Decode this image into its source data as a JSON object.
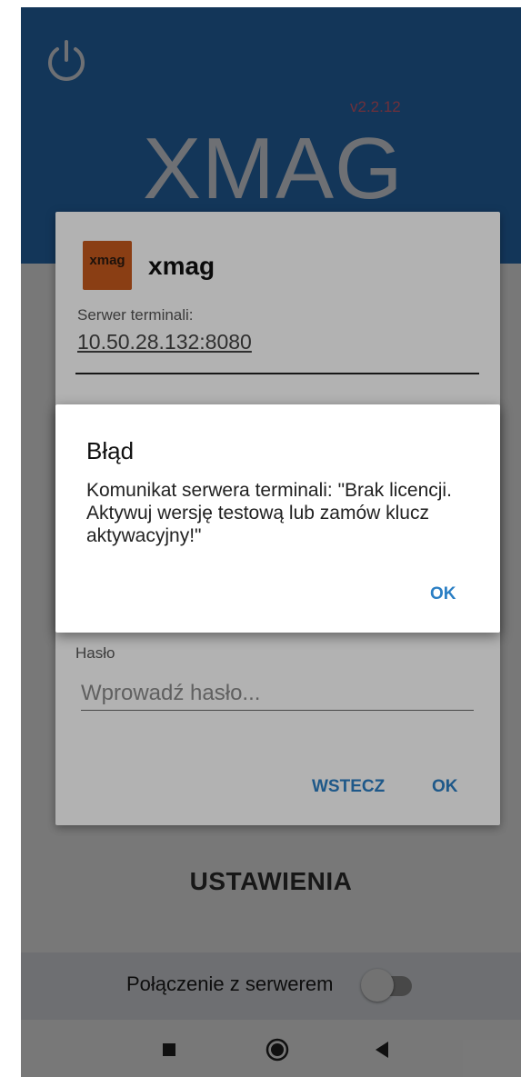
{
  "header": {
    "version": "v2.2.12",
    "brand_title": "XMAG",
    "background_color": "#2a73bd",
    "power_icon": "power-icon"
  },
  "main": {
    "settings_label": "USTAWIENIA"
  },
  "bottom_bar": {
    "connection_label": "Połączenie z serwerem",
    "connection_toggle_on": false
  },
  "login_dialog": {
    "app_icon_text": "xmag",
    "app_name": "xmag",
    "server_label": "Serwer terminali:",
    "server_value": "10.50.28.132:8080",
    "password_label": "Hasło",
    "password_placeholder": "Wprowadź hasło...",
    "back_button": "WSTECZ",
    "ok_button": "OK"
  },
  "error_dialog": {
    "title": "Błąd",
    "message": "Komunikat serwera terminali: \"Brak licencji. Aktywuj wersję testową lub zamów klucz aktywacyjny!\"",
    "ok_button": "OK"
  },
  "nav_bar": {
    "icons": [
      "recents-icon",
      "home-icon",
      "back-icon"
    ]
  },
  "colors": {
    "accent": "#2b7fc4",
    "version_color": "#e8667e",
    "app_icon_color": "#c65a1e"
  }
}
